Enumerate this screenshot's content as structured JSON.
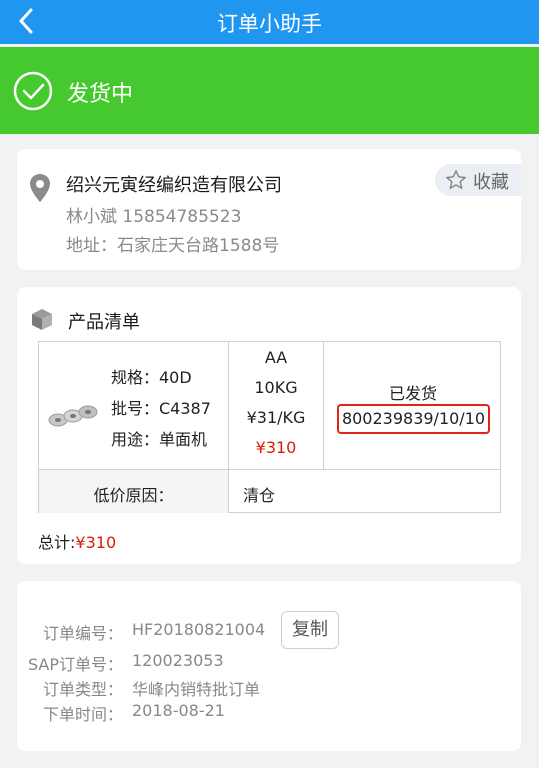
{
  "header": {
    "title": "订单小助手",
    "back_icon": "chevron-left-icon",
    "color": "#1f97f0"
  },
  "status": {
    "text": "发货中",
    "icon": "check-circle-icon",
    "color": "#45c92f"
  },
  "address": {
    "company": "绍兴元寅经编织造有限公司",
    "contact": "林小斌 15854785523",
    "address": "地址：石家庄天台路1588号",
    "favorite_label": "收藏"
  },
  "products": {
    "title": "产品清单",
    "item": {
      "spec": "规格：40D",
      "batch": "批号：C4387",
      "usage": "用途：单面机",
      "grade": "AA",
      "weight": "10KG",
      "unit_price": "¥31/KG",
      "price": "¥310",
      "ship_status": "已发货",
      "tracking": "800239839/10/10"
    },
    "reason_label": "低价原因：",
    "reason_value": "清仓",
    "total_label": "总计:",
    "total_amount": "¥310"
  },
  "order": {
    "number_label": "订单编号：",
    "number_value": "HF20180821004",
    "copy_label": "复制",
    "sap_label": "SAP订单号：",
    "sap_value": "120023053",
    "type_label": "订单类型：",
    "type_value": "华峰内销特批订单",
    "time_label": "下单时间：",
    "time_value": "2018-08-21"
  }
}
